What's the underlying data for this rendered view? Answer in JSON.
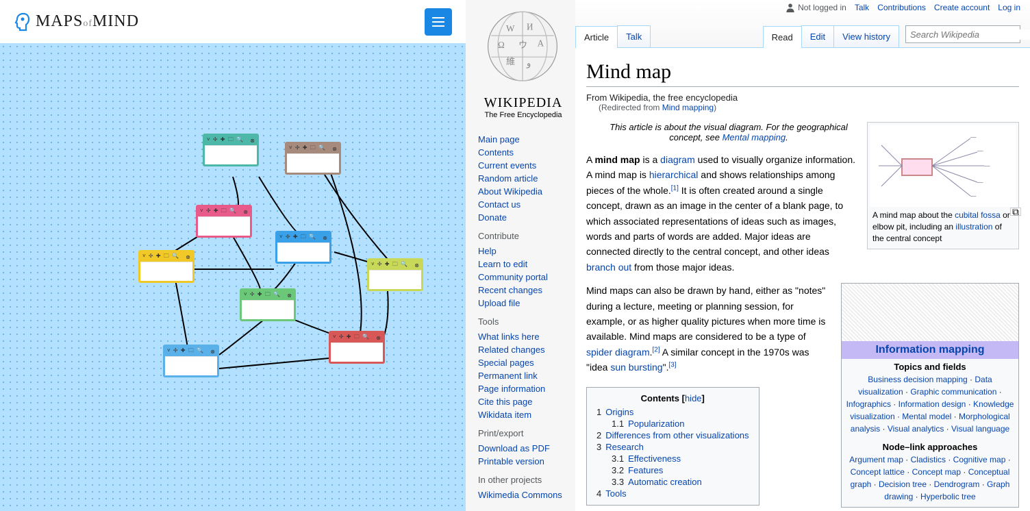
{
  "left": {
    "logo_text_pre": "MAPS",
    "logo_text_of": "of",
    "logo_text_post": "MIND",
    "box_icons": "˅ ✢ ✚ 🗀 🔍",
    "box_close": "⊗"
  },
  "wiki": {
    "top_links": {
      "not_logged": "Not logged in",
      "talk": "Talk",
      "contrib": "Contributions",
      "create": "Create account",
      "login": "Log in"
    },
    "wordmark": "WIKIPEDIA",
    "tagline": "The Free Encyclopedia",
    "nav_main": [
      "Main page",
      "Contents",
      "Current events",
      "Random article",
      "About Wikipedia",
      "Contact us",
      "Donate"
    ],
    "nav_contribute_h": "Contribute",
    "nav_contribute": [
      "Help",
      "Learn to edit",
      "Community portal",
      "Recent changes",
      "Upload file"
    ],
    "nav_tools_h": "Tools",
    "nav_tools": [
      "What links here",
      "Related changes",
      "Special pages",
      "Permanent link",
      "Page information",
      "Cite this page",
      "Wikidata item"
    ],
    "nav_print_h": "Print/export",
    "nav_print": [
      "Download as PDF",
      "Printable version"
    ],
    "nav_other_h": "In other projects",
    "nav_other": [
      "Wikimedia Commons"
    ],
    "tabs_left": {
      "article": "Article",
      "talk": "Talk"
    },
    "tabs_right": {
      "read": "Read",
      "edit": "Edit",
      "history": "View history"
    },
    "search_placeholder": "Search Wikipedia",
    "title": "Mind map",
    "subtitle": "From Wikipedia, the free encyclopedia",
    "redirect_pre": "(Redirected from ",
    "redirect_link": "Mind mapping",
    "redirect_post": ")",
    "hatnote_pre": "This article is about the visual diagram. For the geographical concept, see ",
    "hatnote_link": "Mental mapping",
    "hatnote_post": ".",
    "p1": {
      "t0": "A ",
      "b0": "mind map",
      "t1": " is a ",
      "l1": "diagram",
      "t2": " used to visually organize information. A mind map is ",
      "l2": "hierarchical",
      "t3": " and shows relationships among pieces of the whole.",
      "sup1": "[1]",
      "t4": " It is often created around a single concept, drawn as an image in the center of a blank page, to which associated representations of ideas such as images, words and parts of words are added. Major ideas are connected directly to the central concept, and other ideas ",
      "l3": "branch out",
      "t5": " from those major ideas."
    },
    "p2": {
      "t0": "Mind maps can also be drawn by hand, either as \"notes\" during a lecture, meeting or planning session, for example, or as higher quality pictures when more time is available. Mind maps are considered to be a type of ",
      "l1": "spider diagram",
      "t1": ".",
      "sup1": "[2]",
      "t2": " A similar concept in the 1970s was \"idea ",
      "l2": "sun bursting",
      "t3": "\".",
      "sup2": "[3]"
    },
    "thumb": {
      "cap_pre": "A mind map about the ",
      "cap_l1": "cubital fossa",
      "cap_mid": " or elbow pit, including an ",
      "cap_l2": "illustration",
      "cap_post": " of the central concept"
    },
    "navbox": {
      "title": "Information mapping",
      "g1_h": "Topics and fields",
      "g1": [
        "Business decision mapping",
        "Data visualization",
        "Graphic communication",
        "Infographics",
        "Information design",
        "Knowledge visualization",
        "Mental model",
        "Morphological analysis",
        "Visual analytics",
        "Visual language"
      ],
      "g2_h": "Node–link approaches",
      "g2": [
        "Argument map",
        "Cladistics",
        "Cognitive map",
        "Concept lattice",
        "Concept map",
        "Conceptual graph",
        "Decision tree",
        "Dendrogram",
        "Graph drawing",
        "Hyperbolic tree"
      ]
    },
    "toc": {
      "title": "Contents",
      "hide": "hide",
      "items": [
        {
          "n": "1",
          "t": "Origins"
        },
        {
          "n": "1.1",
          "t": "Popularization",
          "sub": true
        },
        {
          "n": "2",
          "t": "Differences from other visualizations"
        },
        {
          "n": "3",
          "t": "Research"
        },
        {
          "n": "3.1",
          "t": "Effectiveness",
          "sub": true
        },
        {
          "n": "3.2",
          "t": "Features",
          "sub": true
        },
        {
          "n": "3.3",
          "t": "Automatic creation",
          "sub": true
        },
        {
          "n": "4",
          "t": "Tools"
        }
      ]
    }
  }
}
